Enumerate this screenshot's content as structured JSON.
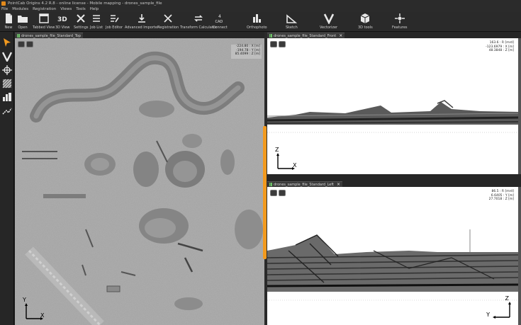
{
  "window": {
    "title": "PointCab Origins 4.2 R.8 - online license - Mobile mapping - drones_sample_file"
  },
  "menu": [
    "File",
    "Modules",
    "Registration",
    "Views",
    "Tools",
    "Help"
  ],
  "toolbar": {
    "new": "New",
    "open": "Open",
    "tabbed_view": "Tabbed View",
    "view3d": "3D View",
    "view3d_glyph": "3D",
    "settings": "Settings",
    "job_list": "Job List",
    "job_editor": "Job Editor",
    "advanced_importer": "Advanced Importer",
    "registration": "Registration",
    "transform_calculator": "Transform Calculator",
    "connect": "Connect",
    "connect_glyph_top": "4",
    "connect_glyph_bottom": "CAD",
    "orthophoto": "Orthophoto",
    "sketch": "Sketch",
    "vectorizer": "Vectorizer",
    "tools3d": "3D tools",
    "features": "Features"
  },
  "views": {
    "top": {
      "tab": "drones_sample_file_Standard_Top",
      "readout": [
        "-224.80 : X [m]",
        "-194.78 : Y [m]",
        "85.4099 : Z [m]"
      ],
      "axis_vertical": "Y",
      "axis_horizontal": "X"
    },
    "front": {
      "tab": "drones_sample_file_Standard_Front",
      "readout": [
        "163.6 : R [mrd]",
        "-123.6979 : X [m]",
        "48.3848 : Z [m]"
      ],
      "axis_vertical": "Z",
      "axis_horizontal": "X"
    },
    "left": {
      "tab": "drones_sample_file_Standard_Left",
      "readout": [
        "86.5 : R [mrd]",
        "6.6405 : Y [m]",
        "27.7018 : Z [m]"
      ],
      "axis_vertical": "Z",
      "axis_horizontal": "Y"
    }
  },
  "colors": {
    "accent": "#f29a1f",
    "tab_icon": "#6fc36a"
  }
}
